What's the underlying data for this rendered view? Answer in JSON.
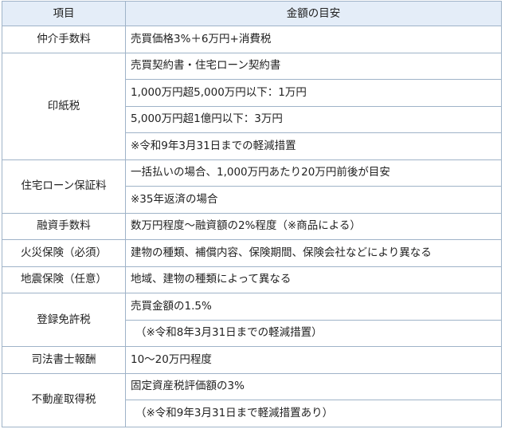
{
  "header": {
    "item": "項目",
    "value": "金額の目安"
  },
  "rows": [
    {
      "item": "仲介手数料",
      "values": [
        "売買価格3%＋6万円+消費税"
      ]
    },
    {
      "item": "印紙税",
      "values": [
        "売買契約書・住宅ローン契約書",
        "1,000万円超5,000万円以下：1万円",
        "5,000万円超1億円以下：3万円",
        "※令和9年3月31日までの軽減措置"
      ]
    },
    {
      "item": "住宅ローン保証料",
      "values": [
        "一括払いの場合、1,000万円あたり20万円前後が目安",
        "※35年返済の場合"
      ]
    },
    {
      "item": "融資手数料",
      "values": [
        "数万円程度～融資額の2%程度（※商品による）"
      ]
    },
    {
      "item": "火災保険（必須）",
      "values": [
        "建物の種類、補償内容、保険期間、保険会社などにより異なる"
      ]
    },
    {
      "item": "地震保険（任意）",
      "values": [
        "地域、建物の種類によって異なる"
      ]
    },
    {
      "item": "登録免許税",
      "values": [
        "売買金額の1.5%",
        "（※令和8年3月31日までの軽減措置）"
      ]
    },
    {
      "item": "司法書士報酬",
      "values": [
        "10～20万円程度"
      ]
    },
    {
      "item": "不動産取得税",
      "values": [
        "固定資産税評価額の3%",
        "（※令和9年3月31日まで軽減措置あり）"
      ]
    }
  ]
}
